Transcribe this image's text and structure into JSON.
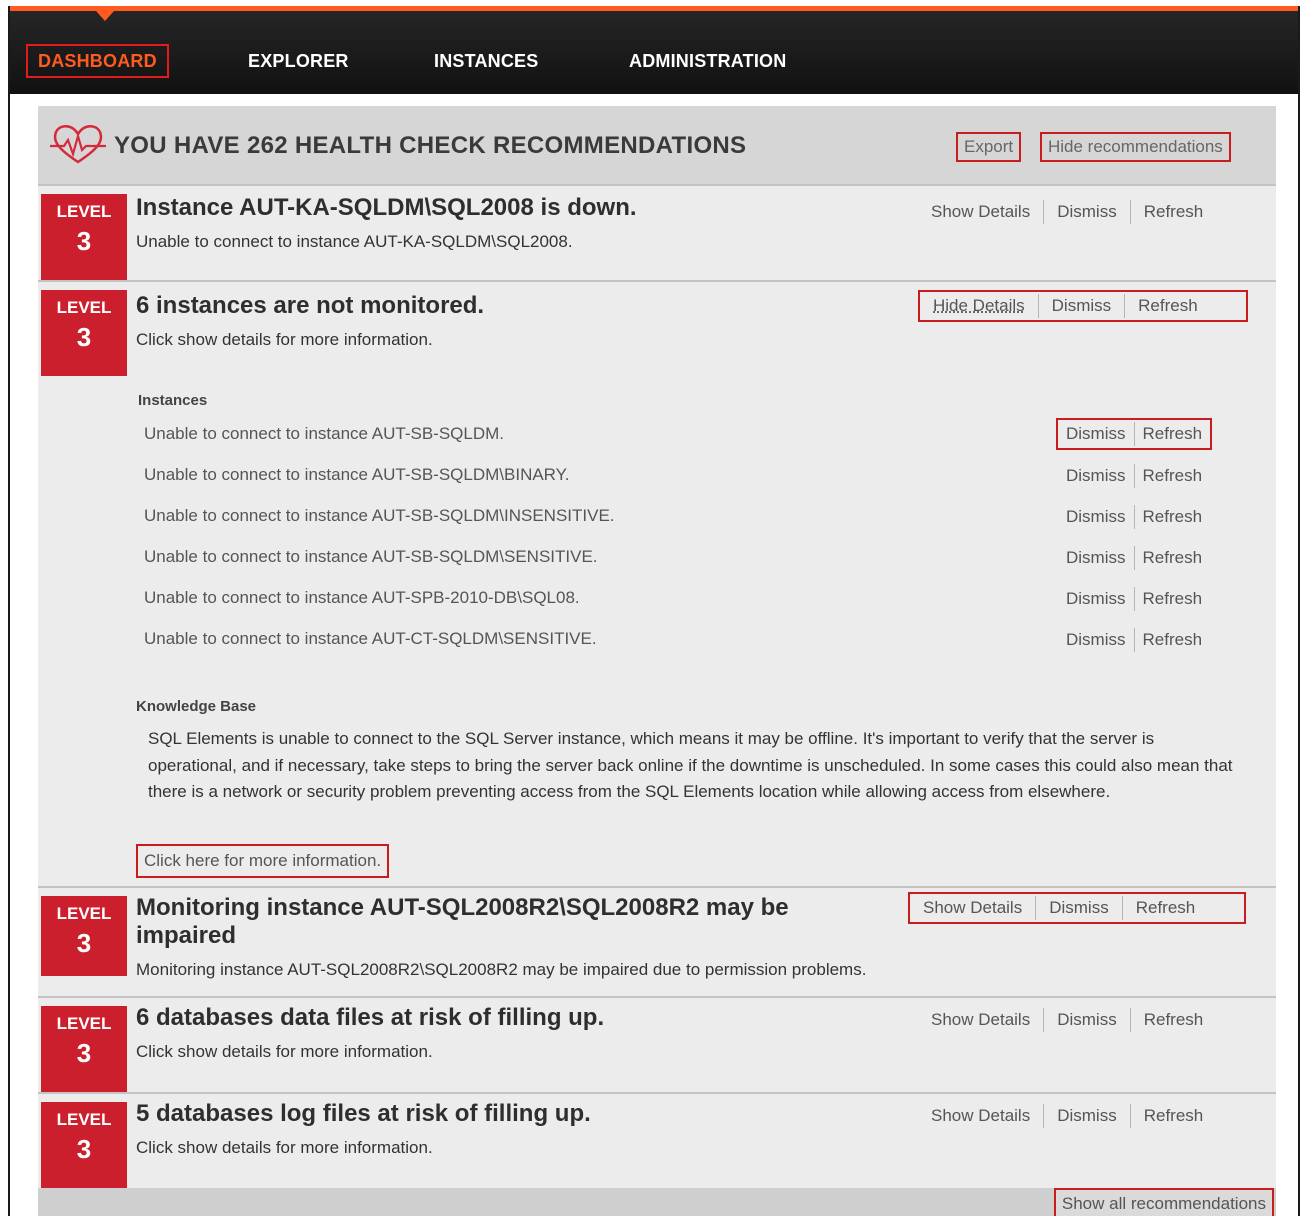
{
  "nav": {
    "items": [
      "DASHBOARD",
      "EXPLORER",
      "INSTANCES",
      "ADMINISTRATION"
    ],
    "active": "DASHBOARD",
    "accent_color": "#ff5a1f"
  },
  "panel": {
    "title": "YOU HAVE 262 HEALTH CHECK RECOMMENDATIONS",
    "export_label": "Export",
    "hide_label": "Hide recommendations",
    "heart_icon": "heart-pulse-icon"
  },
  "actions": {
    "show_details": "Show Details",
    "hide_details": "Hide Details",
    "dismiss": "Dismiss",
    "refresh": "Refresh"
  },
  "level": {
    "label": "LEVEL",
    "color": "#cc1f2e"
  },
  "recommendations": [
    {
      "level": "3",
      "title": "Instance AUT-KA-SQLDM\\SQL2008 is down.",
      "description": "Unable to connect to instance AUT-KA-SQLDM\\SQL2008."
    },
    {
      "level": "3",
      "title": "6 instances are not monitored.",
      "description": "Click show details for more information."
    },
    {
      "level": "3",
      "title": "Monitoring instance AUT-SQL2008R2\\SQL2008R2 may be impaired",
      "description": "Monitoring instance AUT-SQL2008R2\\SQL2008R2 may be impaired due to permission problems."
    },
    {
      "level": "3",
      "title": "6 databases data files at risk of filling up.",
      "description": "Click show details for more information."
    },
    {
      "level": "3",
      "title": "5 databases log files at risk of filling up.",
      "description": "Click show details for more information."
    }
  ],
  "details": {
    "instances_label": "Instances",
    "instances": [
      "Unable to connect to instance AUT-SB-SQLDM.",
      "Unable to connect to instance AUT-SB-SQLDM\\BINARY.",
      "Unable to connect to instance AUT-SB-SQLDM\\INSENSITIVE.",
      "Unable to connect to instance AUT-SB-SQLDM\\SENSITIVE.",
      "Unable to connect to instance AUT-SPB-2010-DB\\SQL08.",
      "Unable to connect to instance AUT-CT-SQLDM\\SENSITIVE."
    ],
    "kb_label": "Knowledge Base",
    "kb_text": "SQL Elements is unable to connect to the SQL Server instance, which means it may be offline. It's important to verify that the server is operational, and if necessary, take steps to bring the server back online if the downtime is unscheduled. In some cases this could also mean that there is a network or security problem preventing access from the SQL Elements location while allowing access from elsewhere.",
    "more_link": "Click here for more information."
  },
  "footer": {
    "show_all_label": "Show all recommendations"
  }
}
